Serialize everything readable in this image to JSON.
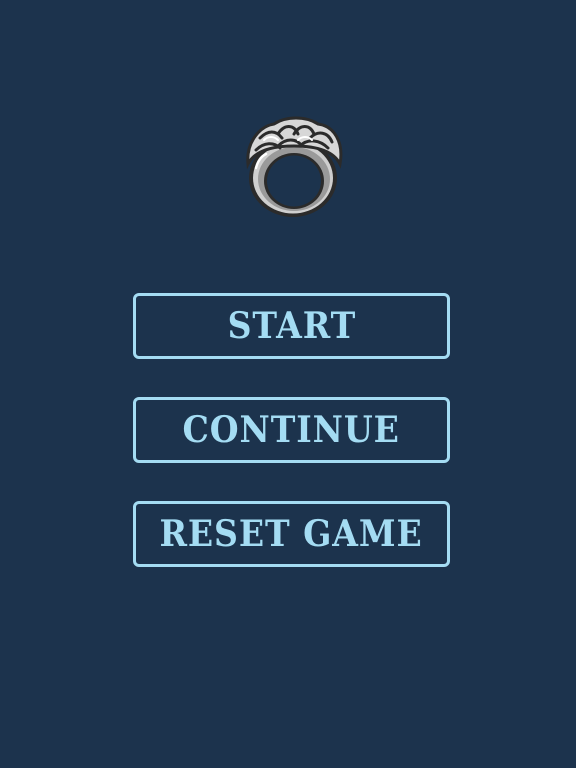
{
  "logo": {
    "icon": "braided-ring-icon"
  },
  "menu": {
    "start_label": "START",
    "continue_label": "CONTINUE",
    "reset_label": "RESET GAME"
  },
  "colors": {
    "background": "#1c334d",
    "accent": "#a4dcf3",
    "ring_metal": "#c9c9c9"
  }
}
